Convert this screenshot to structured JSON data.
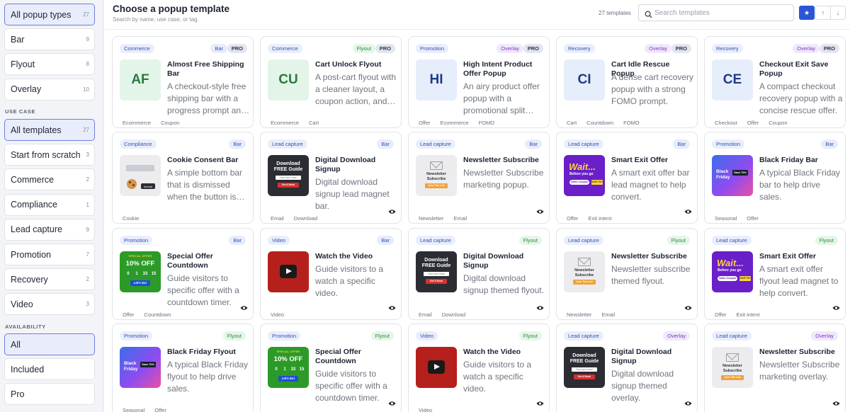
{
  "sidebar": {
    "popup_types": [
      {
        "label": "All popup types",
        "count": "27",
        "active": true
      },
      {
        "label": "Bar",
        "count": "9"
      },
      {
        "label": "Flyout",
        "count": "8"
      },
      {
        "label": "Overlay",
        "count": "10"
      }
    ],
    "use_case_heading": "USE CASE",
    "use_cases": [
      {
        "label": "All templates",
        "count": "27",
        "active": true
      },
      {
        "label": "Start from scratch",
        "count": "3"
      },
      {
        "label": "Commerce",
        "count": "2"
      },
      {
        "label": "Compliance",
        "count": "1"
      },
      {
        "label": "Lead capture",
        "count": "9"
      },
      {
        "label": "Promotion",
        "count": "7"
      },
      {
        "label": "Recovery",
        "count": "2"
      },
      {
        "label": "Video",
        "count": "3"
      }
    ],
    "availability_heading": "AVAILABILITY",
    "availability": [
      {
        "label": "All",
        "active": true
      },
      {
        "label": "Included"
      },
      {
        "label": "Pro"
      }
    ]
  },
  "header": {
    "title": "Choose a popup template",
    "subtitle": "Search by name, use case, or tag.",
    "count": "27 templates",
    "search_placeholder": "Search templates",
    "star_icon": "★",
    "up_icon": "↑",
    "down_icon": "↓"
  },
  "colors": {
    "accent": "#2a56d6",
    "active_border": "#6d7fe0",
    "active_bg": "#e9edfb"
  },
  "cards": [
    {
      "category": "Commerce",
      "type": "Bar",
      "pro": "PRO",
      "abbr": "AF",
      "thumb": "abbr",
      "thumb_bg": "#e3f5e8",
      "thumb_color": "#2b7a3e",
      "title": "Almost Free Shipping Bar",
      "desc": "A checkout-style free shipping bar with a progress prompt and a coupon action.",
      "tags": [
        "Ecommerce",
        "Coupon"
      ]
    },
    {
      "category": "Commerce",
      "type": "Flyout",
      "pro": "PRO",
      "abbr": "CU",
      "thumb": "abbr",
      "thumb_bg": "#e3f5e8",
      "thumb_color": "#2b7a3e",
      "title": "Cart Unlock Flyout",
      "desc": "A post-cart flyout with a cleaner layout, a coupon action, and urgency.",
      "tags": [
        "Ecommerce",
        "Cart"
      ]
    },
    {
      "category": "Promotion",
      "type": "Overlay",
      "pro": "PRO",
      "abbr": "HI",
      "thumb": "abbr",
      "thumb_bg": "#e6eefb",
      "thumb_color": "#1f3a8a",
      "title": "High Intent Product Offer Popup",
      "desc": "An airy product offer popup with a promotional split layout.",
      "tags": [
        "Offer",
        "Ecommerce",
        "FOMO"
      ]
    },
    {
      "category": "Recovery",
      "type": "Overlay",
      "pro": "PRO",
      "abbr": "CI",
      "thumb": "abbr",
      "thumb_bg": "#e6eefb",
      "thumb_color": "#1f3a8a",
      "title": "Cart Idle Rescue Popup",
      "desc": "A dense cart recovery popup with a strong FOMO prompt.",
      "tags": [
        "Cart",
        "Countdown",
        "FOMO"
      ]
    },
    {
      "category": "Recovery",
      "type": "Overlay",
      "pro": "PRO",
      "abbr": "CE",
      "thumb": "abbr",
      "thumb_bg": "#e6eefb",
      "thumb_color": "#1f3a8a",
      "title": "Checkout Exit Save Popup",
      "desc": "A compact checkout recovery popup with a concise rescue offer.",
      "tags": [
        "Checkout",
        "Offer",
        "Coupon"
      ]
    },
    {
      "category": "Compliance",
      "type": "Bar",
      "thumb": "cookie",
      "title": "Cookie Consent Bar",
      "desc": "A simple bottom bar that is dismissed when the button is clicked.",
      "tags": [
        "Cookie"
      ],
      "cookie_button": "Accept"
    },
    {
      "category": "Lead capture",
      "type": "Bar",
      "thumb": "download",
      "title": "Digital Download Signup",
      "desc": "Digital download signup lead magnet bar.",
      "tags": [
        "Email",
        "Download"
      ],
      "eye": true,
      "dl_line1": "Download",
      "dl_line2": "FREE Guide",
      "dl_input": "Enter your email",
      "dl_btn": "Get it Now!"
    },
    {
      "category": "Lead capture",
      "type": "Bar",
      "thumb": "newsletter",
      "title": "Newsletter Subscribe",
      "desc": "Newsletter Subscribe marketing popup.",
      "tags": [
        "Newsletter",
        "Email"
      ],
      "eye": true,
      "nl_line1": "Newsletter",
      "nl_line2": "Subscribe",
      "nl_btn": "Join The List"
    },
    {
      "category": "Lead capture",
      "type": "Bar",
      "thumb": "wait",
      "title": "Smart Exit Offer",
      "desc": "A smart exit offer bar lead magnet to help convert.",
      "tags": [
        "Offer",
        "Exit intent"
      ],
      "eye": true,
      "w_big": "Wait...",
      "w_small": "Before you go",
      "w_btn": "Claim Coupon",
      "w_badge": "SAVE 70%"
    },
    {
      "category": "Promotion",
      "type": "Bar",
      "thumb": "blackfriday",
      "title": "Black Friday Bar",
      "desc": "A typical Black Friday bar to help drive sales.",
      "tags": [
        "Seasonal",
        "Offer"
      ],
      "bf_line1": "Black",
      "bf_line2": "Friday",
      "bf_badge": "Save 70%"
    },
    {
      "category": "Promotion",
      "type": "Bar",
      "thumb": "special",
      "title": "Special Offer Countdown",
      "desc": "Guide visitors to specific offer with a countdown timer.",
      "tags": [
        "Offer",
        "Countdown"
      ],
      "eye": true,
      "so_top": "SPECIAL OFFER",
      "so_big": "10% OFF",
      "so_digits": [
        "0",
        "1",
        "33",
        "15"
      ],
      "so_btn": "Let's Go!"
    },
    {
      "category": "Video",
      "type": "Bar",
      "thumb": "video",
      "title": "Watch the Video",
      "desc": "Guide visitors to a watch a specific video.",
      "tags": [
        "Video"
      ],
      "eye": true
    },
    {
      "category": "Lead capture",
      "type": "Flyout",
      "thumb": "download",
      "title": "Digital Download Signup",
      "desc": "Digital download signup themed flyout.",
      "tags": [
        "Email",
        "Download"
      ],
      "eye": true,
      "dl_line1": "Download",
      "dl_line2": "FREE Guide",
      "dl_input": "Enter your email",
      "dl_btn": "Get it Now!"
    },
    {
      "category": "Lead capture",
      "type": "Flyout",
      "thumb": "newsletter",
      "title": "Newsletter Subscribe",
      "desc": "Newsletter subscribe themed flyout.",
      "tags": [
        "Newsletter",
        "Email"
      ],
      "eye": true,
      "nl_line1": "Newsletter",
      "nl_line2": "Subscribe",
      "nl_btn": "Join The List"
    },
    {
      "category": "Lead capture",
      "type": "Flyout",
      "thumb": "wait",
      "title": "Smart Exit Offer",
      "desc": "A smart exit offer flyout lead magnet to help convert.",
      "tags": [
        "Offer",
        "Exit intent"
      ],
      "eye": true,
      "w_big": "Wait...",
      "w_small": "Before you go",
      "w_btn": "Claim Coupon",
      "w_badge": "SAVE 70%"
    },
    {
      "category": "Promotion",
      "type": "Flyout",
      "thumb": "blackfriday",
      "title": "Black Friday Flyout",
      "desc": "A typical Black Friday flyout to help drive sales.",
      "tags": [
        "Seasonal",
        "Offer"
      ],
      "bf_line1": "Black",
      "bf_line2": "Friday",
      "bf_badge": "Save 70%"
    },
    {
      "category": "Promotion",
      "type": "Flyout",
      "thumb": "special",
      "title": "Special Offer Countdown",
      "desc": "Guide visitors to specific offer with a countdown timer.",
      "tags": [],
      "eye": true,
      "so_top": "SPECIAL OFFER",
      "so_big": "10% OFF",
      "so_digits": [
        "0",
        "1",
        "33",
        "15"
      ],
      "so_btn": "Let's Go!"
    },
    {
      "category": "Video",
      "type": "Flyout",
      "thumb": "video",
      "title": "Watch the Video",
      "desc": "Guide visitors to a watch a specific video.",
      "tags": [
        "Video"
      ],
      "eye": true
    },
    {
      "category": "Lead capture",
      "type": "Overlay",
      "thumb": "download",
      "title": "Digital Download Signup",
      "desc": "Digital download signup themed overlay.",
      "tags": [],
      "eye": true,
      "dl_line1": "Download",
      "dl_line2": "FREE Guide",
      "dl_input": "Enter your email",
      "dl_btn": "Get it Now!"
    },
    {
      "category": "Lead capture",
      "type": "Overlay",
      "thumb": "newsletter",
      "title": "Newsletter Subscribe",
      "desc": "Newsletter Subscribe marketing overlay.",
      "tags": [],
      "eye": true,
      "nl_line1": "Newsletter",
      "nl_line2": "Subscribe",
      "nl_btn": "Join The List"
    }
  ]
}
